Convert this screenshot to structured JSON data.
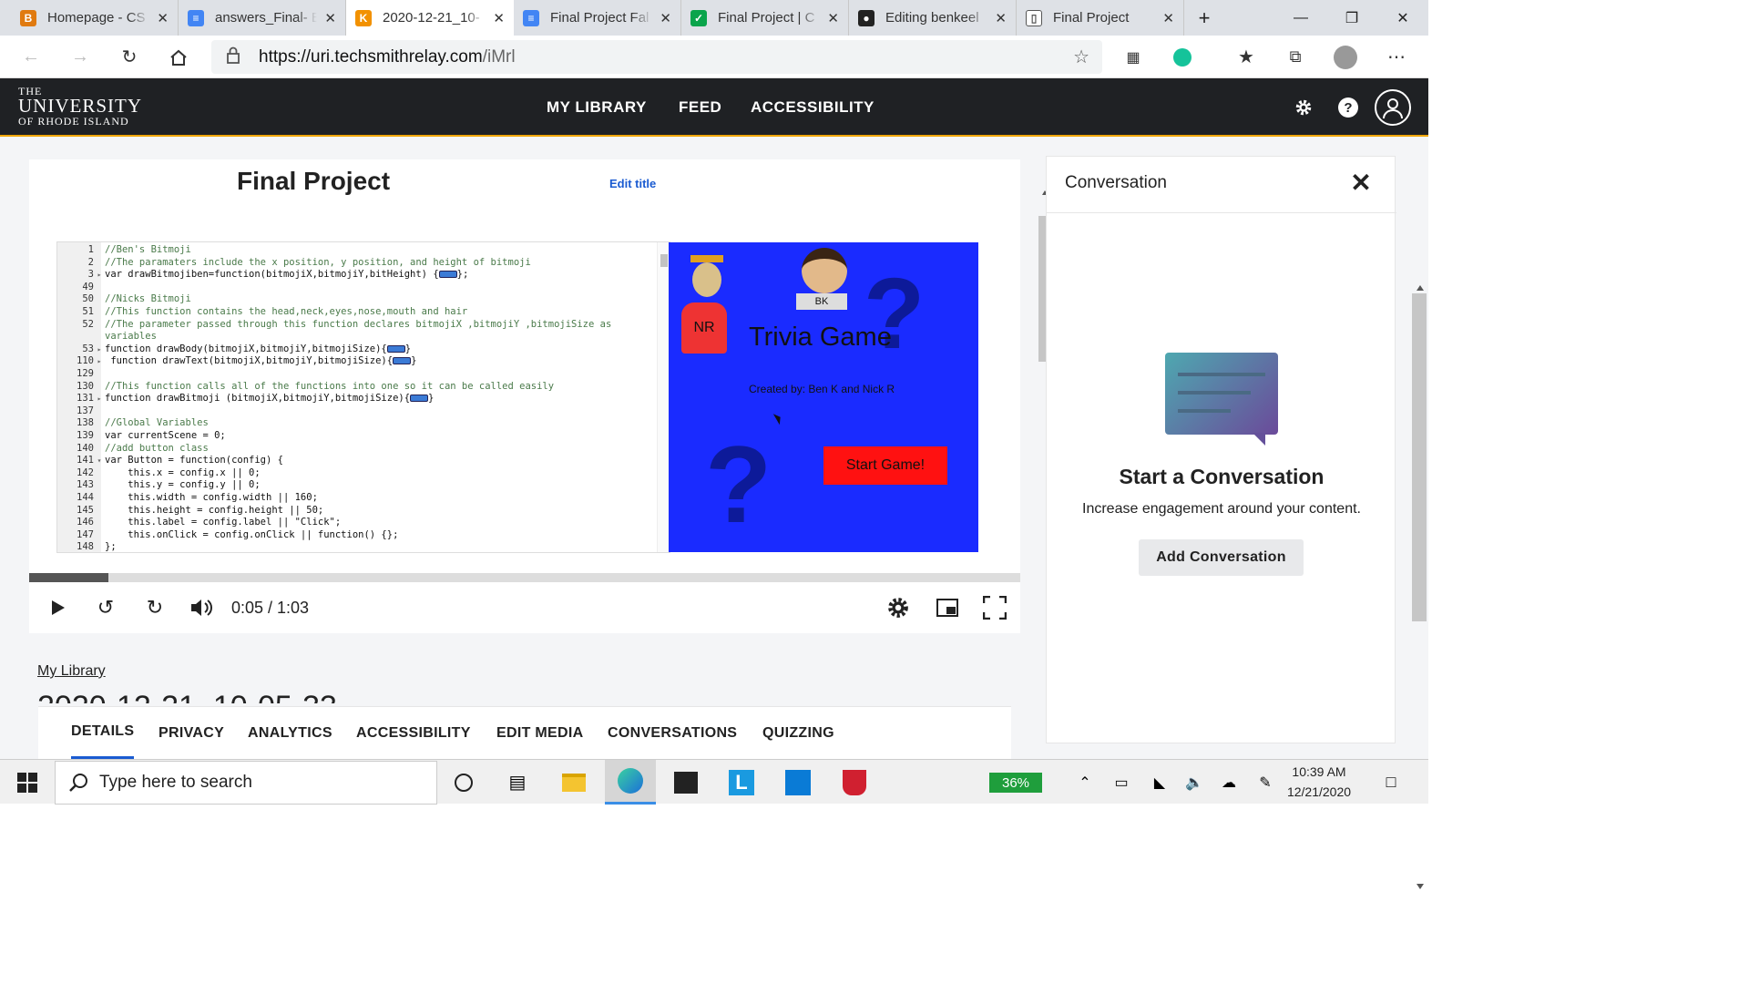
{
  "browser": {
    "tabs": [
      {
        "label": "Homepage - CS",
        "color": "#e07a10",
        "glyph": "B"
      },
      {
        "label": "answers_Final- E",
        "color": "#4285f4",
        "glyph": "≡"
      },
      {
        "label": "2020-12-21_10-",
        "color": "#f29100",
        "glyph": "K"
      },
      {
        "label": "Final Project Fal",
        "color": "#4285f4",
        "glyph": "≡"
      },
      {
        "label": "Final Project | C",
        "color": "#0aa44b",
        "glyph": "✓"
      },
      {
        "label": "Editing benkeel",
        "color": "#222",
        "glyph": "●"
      },
      {
        "label": "Final Project",
        "color": "#ffffff",
        "glyph": "▯"
      }
    ],
    "new_tab": "+",
    "url_domain": "https://uri.techsmithrelay.com",
    "url_path": "/iMrl",
    "window": {
      "minimize": "—",
      "restore": "❐",
      "close": "✕"
    }
  },
  "site": {
    "logo": {
      "line1": "THE",
      "line2": "UNIVERSITY",
      "line3": "OF RHODE ISLAND"
    },
    "nav": [
      "MY LIBRARY",
      "FEED",
      "ACCESSIBILITY"
    ]
  },
  "video": {
    "title": "Final Project",
    "edit_title": "Edit title",
    "time": "0:05 / 1:03",
    "progress": 0.08,
    "code_lines": [
      {
        "n": "1",
        "a": "",
        "t": "//Ben's Bitmoji",
        "c": true
      },
      {
        "n": "2",
        "a": "",
        "t": "//The paramaters include the x position, y position, and height of bitmoji",
        "c": true
      },
      {
        "n": "3",
        "a": "▸",
        "t": "var drawBitmojiben=function(bitmojiX,bitmojiY,bitHeight) {",
        "f": "};"
      },
      {
        "n": "49",
        "a": "",
        "t": ""
      },
      {
        "n": "50",
        "a": "",
        "t": "//Nicks Bitmoji",
        "c": true
      },
      {
        "n": "51",
        "a": "",
        "t": "//This function contains the head,neck,eyes,nose,mouth and hair",
        "c": true
      },
      {
        "n": "52",
        "a": "",
        "t": "//The parameter passed through this function declares bitmojiX ,bitmojiY ,bitmojiSize as",
        "c": true
      },
      {
        "n": "",
        "a": "",
        "t": "variables",
        "c": true
      },
      {
        "n": "53",
        "a": "▸",
        "t": "function drawBody(bitmojiX,bitmojiY,bitmojiSize){",
        "f": "}"
      },
      {
        "n": "110",
        "a": "▸",
        "t": " function drawText(bitmojiX,bitmojiY,bitmojiSize){",
        "f": "}"
      },
      {
        "n": "129",
        "a": "",
        "t": ""
      },
      {
        "n": "130",
        "a": "",
        "t": "//This function calls all of the functions into one so it can be called easily",
        "c": true
      },
      {
        "n": "131",
        "a": "▸",
        "t": "function drawBitmoji (bitmojiX,bitmojiY,bitmojiSize){",
        "f": "}"
      },
      {
        "n": "137",
        "a": "",
        "t": ""
      },
      {
        "n": "138",
        "a": "",
        "t": "//Global Variables",
        "c": true
      },
      {
        "n": "139",
        "a": "",
        "t": "var currentScene = 0;"
      },
      {
        "n": "140",
        "a": "",
        "t": "//add button class",
        "c": true
      },
      {
        "n": "141",
        "a": "▾",
        "t": "var Button = function(config) {"
      },
      {
        "n": "142",
        "a": "",
        "t": "    this.x = config.x || 0;"
      },
      {
        "n": "143",
        "a": "",
        "t": "    this.y = config.y || 0;"
      },
      {
        "n": "144",
        "a": "",
        "t": "    this.width = config.width || 160;"
      },
      {
        "n": "145",
        "a": "",
        "t": "    this.height = config.height || 50;"
      },
      {
        "n": "146",
        "a": "",
        "t": "    this.label = config.label || \"Click\";"
      },
      {
        "n": "147",
        "a": "",
        "t": "    this.onClick = config.onClick || function() {};"
      },
      {
        "n": "148",
        "a": "",
        "t": "};"
      }
    ],
    "game": {
      "title": "Trivia Game",
      "credit": "Created by: Ben K and Nick R",
      "button": "Start Game!",
      "nr": "NR",
      "bk": "BK",
      "q": "?"
    }
  },
  "page": {
    "my_library": "My Library",
    "partial_title": "2020-12-21_10-05-33",
    "tabs": [
      "DETAILS",
      "PRIVACY",
      "ANALYTICS",
      "ACCESSIBILITY",
      "EDIT MEDIA",
      "CONVERSATIONS",
      "QUIZZING"
    ]
  },
  "conversation": {
    "title": "Conversation",
    "heading": "Start a Conversation",
    "text": "Increase engagement around your content.",
    "button": "Add Conversation"
  },
  "taskbar": {
    "search_placeholder": "Type here to search",
    "battery": "36%",
    "time": "10:39 AM",
    "date": "12/21/2020"
  }
}
